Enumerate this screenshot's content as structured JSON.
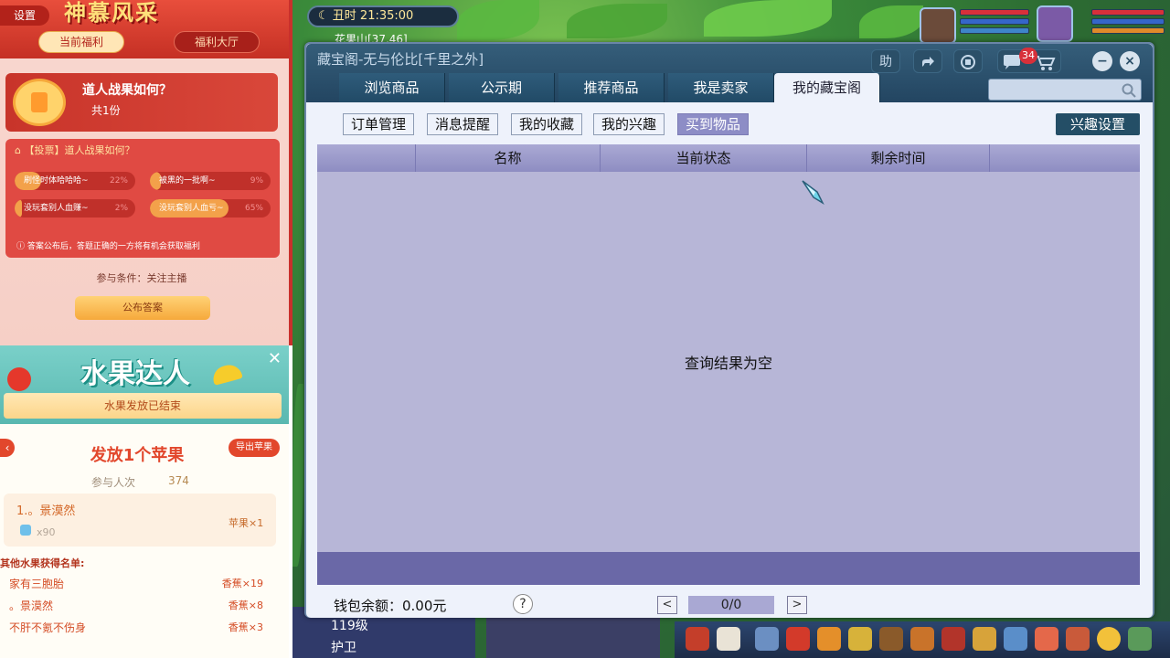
{
  "stream_top": {
    "settings": "设置",
    "logo": "神慕风采",
    "tabs": [
      "当前福利",
      "福利大厅"
    ],
    "card_title": "道人战果如何？",
    "card_sub": "共1份",
    "vote_head": "【投票】道人战果如何？",
    "options": [
      {
        "label": "刷怪时体哈哈哈~",
        "pct": "22%",
        "value": 22
      },
      {
        "label": "被黑的一批啊~",
        "pct": "9%",
        "value": 9
      },
      {
        "label": "没玩套别人血赚~",
        "pct": "2%",
        "value": 2
      },
      {
        "label": "没玩套别人血亏~",
        "pct": "65%",
        "value": 65
      }
    ],
    "note": "答案公布后，答题正确的一方将有机会获取福利",
    "condition": "参与条件：关注主播",
    "button": "公布答案"
  },
  "fruit": {
    "title": "水果达人",
    "close": "✕",
    "ended": "水果发放已结束",
    "back": "‹",
    "heading": "发放1个苹果",
    "export": "导出苹果",
    "participants_label": "参与人次",
    "participants": "374",
    "winner_name": "1.。景漠然",
    "winner_x": "x90",
    "winner_reward": "苹果×1",
    "others_label": "其他水果获得名单:",
    "others": [
      {
        "name": "家有三胞胎",
        "reward": "香蕉×19"
      },
      {
        "name": "。景漠然",
        "reward": "香蕉×8"
      },
      {
        "name": "不肝不氪不伤身",
        "reward": "香蕉×3"
      }
    ]
  },
  "hud": {
    "clock": "丑时  21:35:00",
    "location": "花果山[37,46]",
    "bottom_a": "119级",
    "bottom_b": "护卫"
  },
  "window": {
    "title": "藏宝阁-无与伦比[千里之外]",
    "help_btn": "助",
    "msg_badge": "34",
    "tabs": [
      "浏览商品",
      "公示期",
      "推荐商品",
      "我是卖家",
      "我的藏宝阁"
    ],
    "active_tab": 4,
    "search_placeholder": "",
    "subtabs": [
      "订单管理",
      "消息提醒",
      "我的收藏",
      "我的兴趣",
      "买到物品"
    ],
    "active_subtab": 4,
    "interest_button": "兴趣设置",
    "columns": [
      "名称",
      "当前状态",
      "剩余时间"
    ],
    "empty_text": "查询结果为空",
    "wallet": "钱包余额：0.00元",
    "help": "?",
    "prev": "<",
    "page": "0/0",
    "next": ">"
  },
  "colors": {
    "title_bar": "#234561",
    "content_bg": "#eef2fb",
    "grid_bg": "#b7b6d7",
    "active_subtab": "#8d8dc6",
    "stream_red": "#e04a43"
  }
}
